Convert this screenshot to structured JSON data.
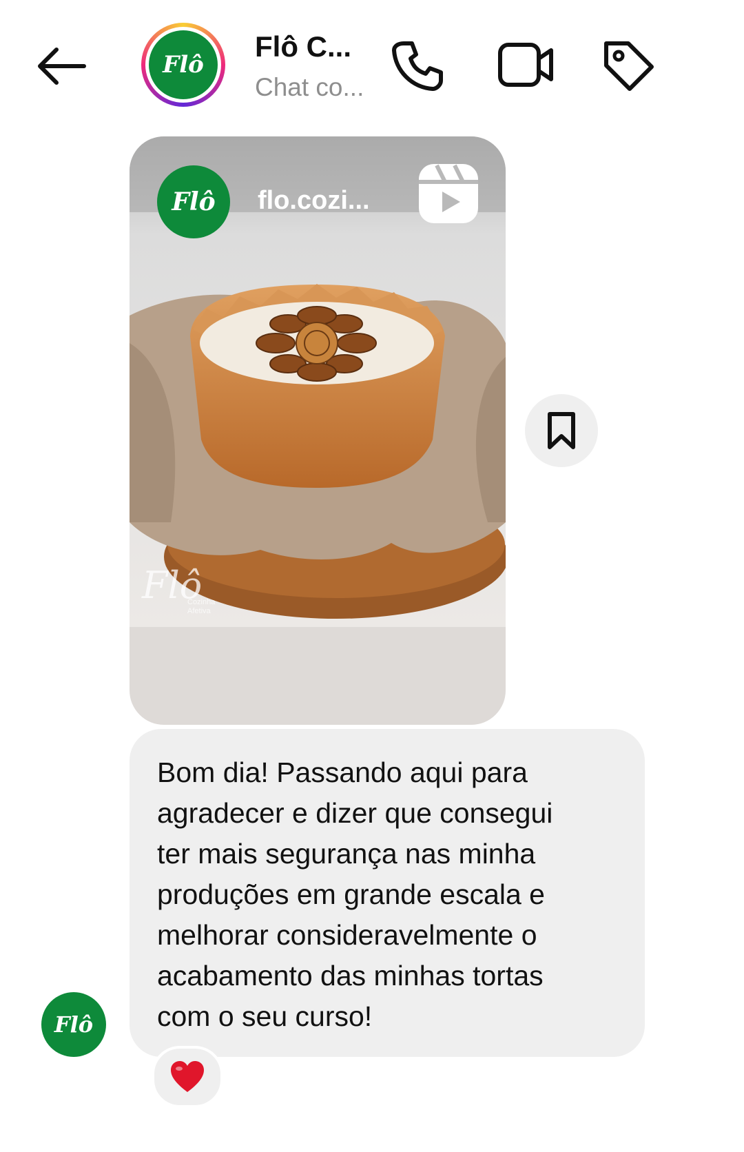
{
  "header": {
    "back_icon": "arrow-left-icon",
    "title": "Flô C...",
    "subtitle": "Chat co...",
    "actions": [
      {
        "name": "audio-call",
        "icon": "phone-icon"
      },
      {
        "name": "video-call",
        "icon": "video-camera-icon"
      },
      {
        "name": "label",
        "icon": "tag-icon"
      }
    ],
    "avatar_text": "Flô"
  },
  "shared_reel": {
    "username": "flo.cozi...",
    "avatar_text": "Flô",
    "type_icon": "reels-icon",
    "watermark": "Flô",
    "watermark_sub": "Cozinha\nAfetiva"
  },
  "save_button": {
    "icon": "bookmark-icon"
  },
  "message": {
    "text": "Bom dia! Passando aqui para\nagradecer e dizer que consegui\nter mais segurança nas minha\nproduções em grande escala e\nmelhorar consideravelmente o\nacabamento das minhas tortas\ncom o seu curso!",
    "sender_avatar_text": "Flô",
    "reaction": "❤️"
  },
  "colors": {
    "brand_green": "#0e8a3a",
    "bubble_bg": "#efefef",
    "muted_text": "#8e8e8e",
    "reaction_red": "#e0162b"
  }
}
